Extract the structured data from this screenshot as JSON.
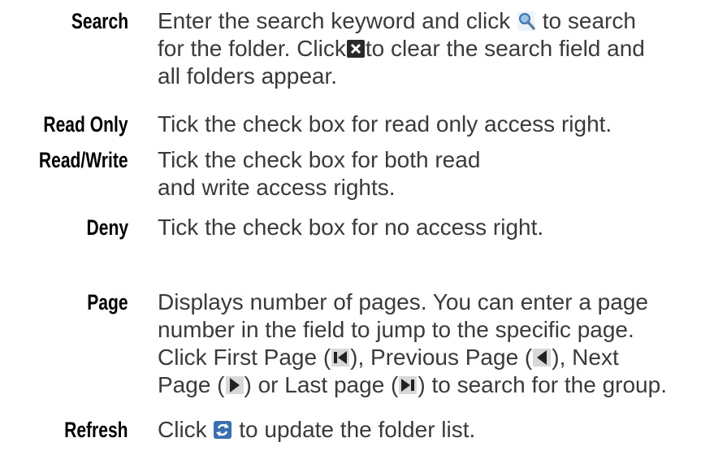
{
  "entries": {
    "search": {
      "term": "Search",
      "line1_a": "Enter the search keyword and click",
      "line1_b": "to search",
      "line2_a": "for the folder. Click",
      "line2_b": "to clear the search field and",
      "line3": "all folders appear."
    },
    "read_only": {
      "term": "Read Only",
      "line1": "Tick the check box for read only access right."
    },
    "read_write": {
      "term": "Read/Write",
      "line1": "Tick the check box for both read",
      "line2": "and write access rights."
    },
    "deny": {
      "term": "Deny",
      "line1": "Tick the check box for no access right."
    },
    "page": {
      "term": "Page",
      "line1": "Displays number of pages. You can enter a page",
      "line2": "number in the field to jump to the specific page.",
      "line3_a": "Click First Page (",
      "line3_b": "), Previous Page (",
      "line3_c": "), Next",
      "line4_a": "Page (",
      "line4_b": ") or Last page (",
      "line4_c": ") to search for the group."
    },
    "refresh": {
      "term": "Refresh",
      "line1_a": "Click",
      "line1_b": "to update the folder list."
    }
  },
  "icons": {
    "search": "search-icon",
    "clear": "clear-x-icon",
    "first_page": "first-page-icon",
    "previous_page": "previous-page-icon",
    "next_page": "next-page-icon",
    "last_page": "last-page-icon",
    "refresh": "refresh-icon"
  },
  "colors": {
    "term_text": "#000000",
    "body_text": "#3a3a3a",
    "icon_blue": "#3a6fb0",
    "icon_dark": "#222222"
  }
}
